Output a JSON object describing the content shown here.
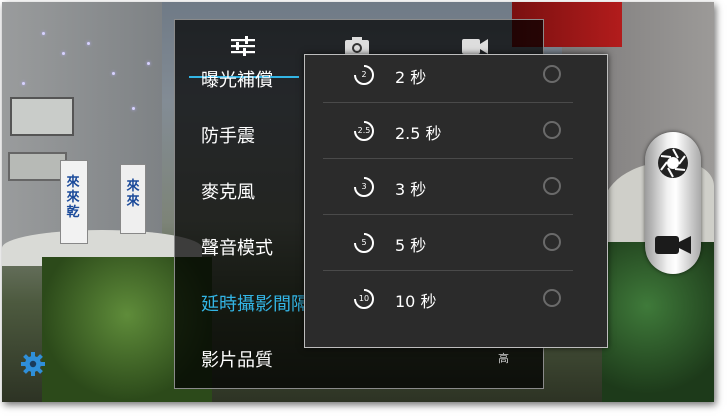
{
  "menu": {
    "tabs": [
      {
        "icon": "sliders-icon"
      },
      {
        "icon": "camera-icon"
      },
      {
        "icon": "video-camera-icon"
      }
    ],
    "items": [
      {
        "label": "曝光補償"
      },
      {
        "label": "防手震"
      },
      {
        "label": "麥克風"
      },
      {
        "label": "聲音模式"
      },
      {
        "label": "延時攝影間隔"
      },
      {
        "label": "影片品質"
      }
    ],
    "active_index": 4,
    "quality_value": "高"
  },
  "interval_popup": {
    "options": [
      {
        "icon_text": "2",
        "label": "2 秒",
        "selected": false
      },
      {
        "icon_text": "2.5",
        "label": "2.5 秒",
        "selected": false
      },
      {
        "icon_text": "3",
        "label": "3 秒",
        "selected": false
      },
      {
        "icon_text": "5",
        "label": "5 秒",
        "selected": false
      },
      {
        "icon_text": "10",
        "label": "10 秒",
        "selected": false
      }
    ]
  },
  "background_signs": {
    "left": "來來乾",
    "right": "來來"
  },
  "colors": {
    "accent": "#33b5e5"
  }
}
